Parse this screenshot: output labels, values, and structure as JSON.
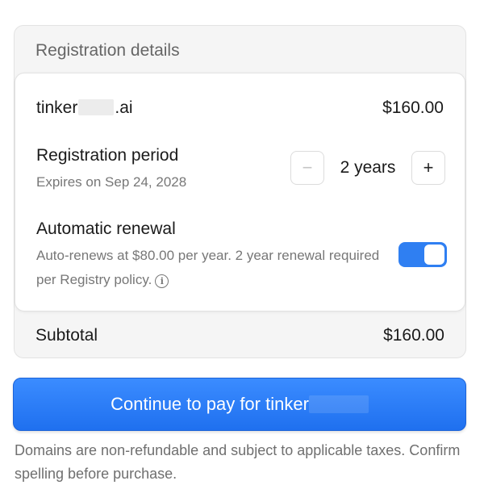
{
  "card": {
    "title": "Registration details"
  },
  "domain": {
    "name_prefix": "tinker",
    "name_suffix": ".ai",
    "price": "$160.00"
  },
  "period": {
    "label": "Registration period",
    "expires": "Expires on Sep 24, 2028",
    "minus_icon": "−",
    "plus_icon": "+",
    "value": "2 years"
  },
  "renewal": {
    "label": "Automatic renewal",
    "description": "Auto-renews at $80.00 per year. 2 year renewal required per Registry policy.",
    "info_icon": "i",
    "enabled": true,
    "toggle_color": "#2f7ff2"
  },
  "subtotal": {
    "label": "Subtotal",
    "price": "$160.00"
  },
  "cta": {
    "label": "Continue to pay for tinker",
    "color": "#2a7df4"
  },
  "footer": {
    "note": "Domains are non-refundable and subject to applicable taxes. Confirm spelling before purchase."
  }
}
